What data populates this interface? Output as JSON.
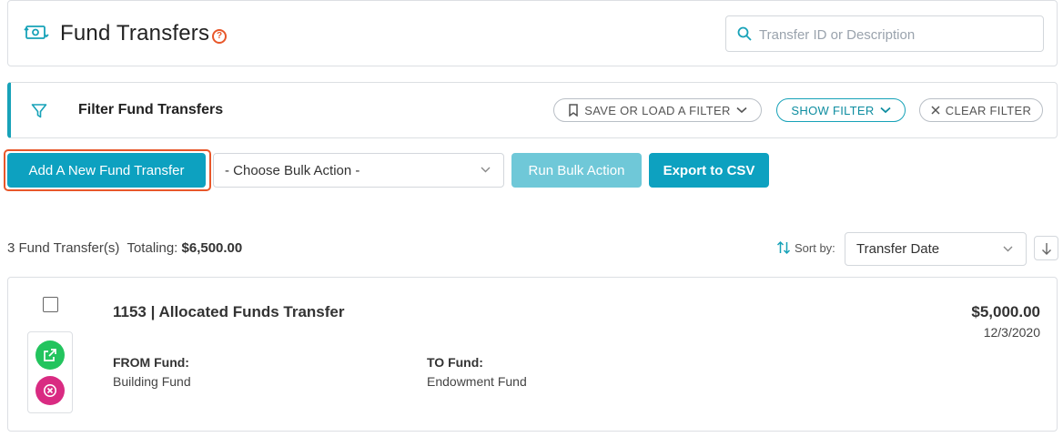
{
  "header": {
    "title": "Fund Transfers",
    "help_symbol": "?",
    "search_placeholder": "Transfer ID or Description",
    "search_value": ""
  },
  "filter": {
    "title": "Filter Fund Transfers",
    "save_load_label": "SAVE OR LOAD A FILTER",
    "show_label": "SHOW FILTER",
    "clear_label": "CLEAR FILTER"
  },
  "actions": {
    "add_label": "Add A New Fund Transfer",
    "bulk_select_value": "- Choose Bulk Action -",
    "run_label": "Run Bulk Action",
    "export_label": "Export to CSV"
  },
  "summary": {
    "count_text": "3 Fund Transfer(s)",
    "totaling_label": "Totaling:",
    "total": "$6,500.00",
    "sort_label": "Sort by:",
    "sort_value": "Transfer Date"
  },
  "records": [
    {
      "title": "1153 | Allocated Funds Transfer",
      "amount": "$5,000.00",
      "date": "12/3/2020",
      "from_label": "FROM Fund:",
      "from_value": "Building Fund",
      "to_label": "TO Fund:",
      "to_value": "Endowment Fund",
      "checked": false
    }
  ],
  "colors": {
    "accent": "#0da1c0",
    "accent_light": "#6fc8d8",
    "highlight_outline": "#e8572a",
    "open_button": "#23c45e",
    "delete_button": "#d92b82"
  },
  "icons": [
    "money-transfer-icon",
    "help-icon",
    "search-icon",
    "filter-icon",
    "bookmark-icon",
    "chevron-down-icon",
    "close-icon",
    "sort-icon",
    "arrow-down-icon",
    "external-link-icon",
    "delete-icon"
  ]
}
